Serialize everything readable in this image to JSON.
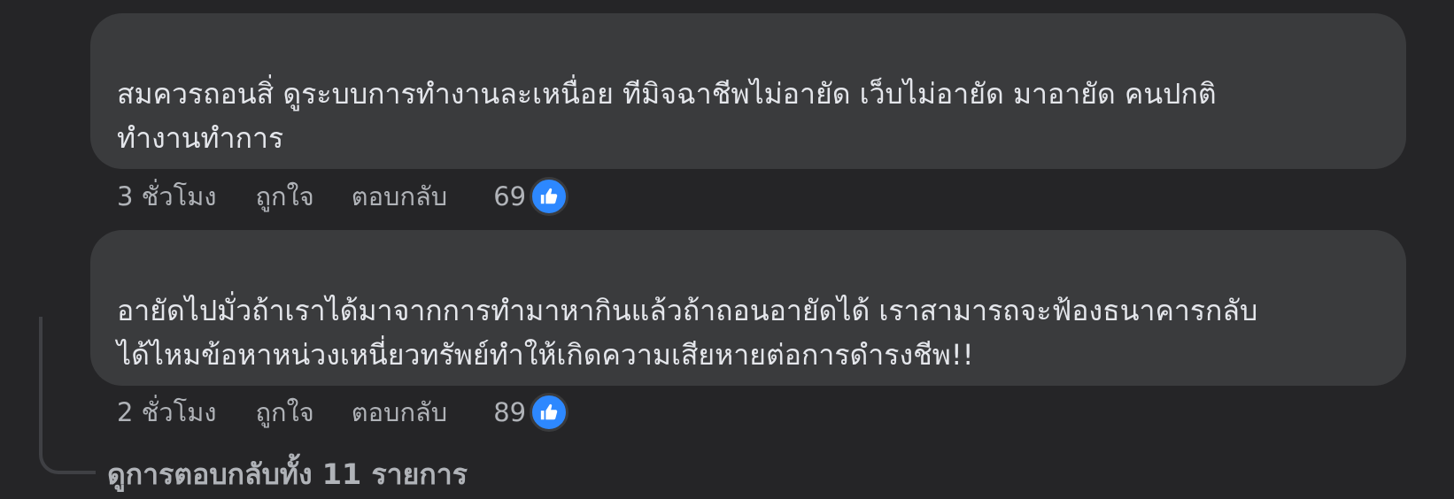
{
  "comments": [
    {
      "text": "สมควรถอนสิ่ ดูระบบการทำงานละเหนื่อย ทีมิจฉาชีพไม่อายัด เว็บไม่อายัด มาอายัด คนปกติ\nทำงานทำการ",
      "time": "3 ชั่วโมง",
      "like_label": "ถูกใจ",
      "reply_label": "ตอบกลับ",
      "reaction_count": "69"
    },
    {
      "text": "อายัดไปมั่วถ้าเราได้มาจากการทำมาหากินแล้วถ้าถอนอายัดได้ เราสามารถจะฟ้องธนาคารกลับ\nได้ไหมข้อหาหน่วงเหนี่ยวทรัพย์ทำให้เกิดความเสียหายต่อการดำรงชีพ!!",
      "time": "2 ชั่วโมง",
      "like_label": "ถูกใจ",
      "reply_label": "ตอบกลับ",
      "reaction_count": "89"
    }
  ],
  "view_replies_label": "ดูการตอบกลับทั้ง 11 รายการ",
  "icons": {
    "reaction": "thumbs-up-icon"
  },
  "colors": {
    "background": "#252527",
    "bubble": "#3a3b3d",
    "text": "#e4e6eb",
    "secondary_text": "#b0b3b8",
    "like_blue": "#2d88ff"
  }
}
